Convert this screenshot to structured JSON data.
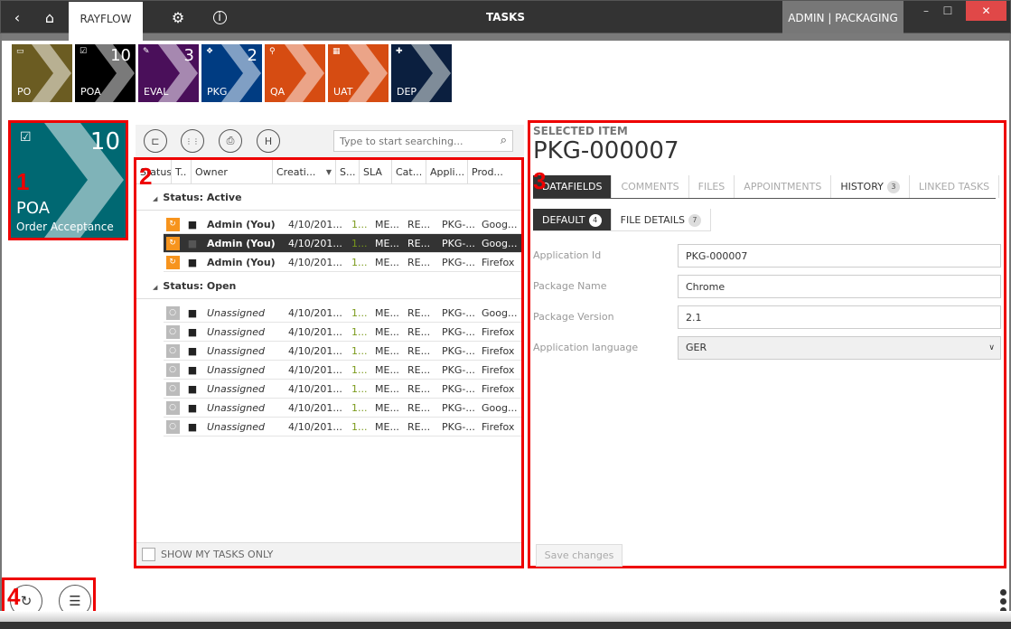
{
  "titlebar": {
    "back_icon": "chevron-left-icon",
    "home_icon": "home-icon",
    "app_tab": "RAYFLOW",
    "settings_icon": "gear-icon",
    "info_icon": "info-icon",
    "title": "TASKS",
    "user": "ADMIN | PACKAGING",
    "minimize": "–",
    "maximize": "☐",
    "close": "✕"
  },
  "tiles": [
    {
      "label": "PO",
      "count": "",
      "color": "#6b5c22",
      "chev": "#b8b092",
      "icon": "▭"
    },
    {
      "label": "POA",
      "count": "10",
      "color": "#000000",
      "chev": "#7a7a7a",
      "icon": "☑"
    },
    {
      "label": "EVAL",
      "count": "3",
      "color": "#4a0f5a",
      "chev": "#a688b0",
      "icon": "✎"
    },
    {
      "label": "PKG",
      "count": "2",
      "color": "#003c82",
      "chev": "#809fc4",
      "icon": "❖"
    },
    {
      "label": "QA",
      "count": "",
      "color": "#d64c12",
      "chev": "#eba488",
      "icon": "⚲"
    },
    {
      "label": "UAT",
      "count": "",
      "color": "#d64c12",
      "chev": "#eba488",
      "icon": "▦"
    },
    {
      "label": "DEP",
      "count": "",
      "color": "#0b1f3f",
      "chev": "#7f8c99",
      "icon": "✚"
    }
  ],
  "selected_stage": {
    "name": "POA",
    "description": "Order Acceptance",
    "count": "10",
    "color": "#006872",
    "chev": "#7fb3b8",
    "icon": "☑"
  },
  "annotations": {
    "a1": "1",
    "a2": "2",
    "a3": "3",
    "a4": "4"
  },
  "toolbar": {
    "btn1_icon": "⊏",
    "btn2_icon": "⋮⋮",
    "btn3_icon": "⎙",
    "btn4_icon": "H",
    "search_placeholder": "Type to start searching...",
    "search_icon": "⌕"
  },
  "grid": {
    "columns": [
      "Status",
      "T..",
      "Owner",
      "Creati...",
      "S...",
      "SLA",
      "Cat...",
      "Appli...",
      "Prod..."
    ],
    "sort_indicator": "▼",
    "groups": [
      {
        "label": "Status: Active",
        "rows": [
          {
            "owner": "Admin (You)",
            "date": "4/10/201...",
            "s": "1...",
            "sla": "ME...",
            "cat": "RE...",
            "app": "PKG-...",
            "prod": "Goog...",
            "selected": false
          },
          {
            "owner": "Admin (You)",
            "date": "4/10/201...",
            "s": "1...",
            "sla": "ME...",
            "cat": "RE...",
            "app": "PKG-...",
            "prod": "Goog...",
            "selected": true
          },
          {
            "owner": "Admin (You)",
            "date": "4/10/201...",
            "s": "1...",
            "sla": "ME...",
            "cat": "RE...",
            "app": "PKG-...",
            "prod": "Firefox",
            "selected": false
          }
        ]
      },
      {
        "label": "Status: Open",
        "rows": [
          {
            "owner": "Unassigned",
            "date": "4/10/201...",
            "s": "1...",
            "sla": "ME...",
            "cat": "RE...",
            "app": "PKG-...",
            "prod": "Goog..."
          },
          {
            "owner": "Unassigned",
            "date": "4/10/201...",
            "s": "1...",
            "sla": "ME...",
            "cat": "RE...",
            "app": "PKG-...",
            "prod": "Firefox"
          },
          {
            "owner": "Unassigned",
            "date": "4/10/201...",
            "s": "1...",
            "sla": "ME...",
            "cat": "RE...",
            "app": "PKG-...",
            "prod": "Firefox"
          },
          {
            "owner": "Unassigned",
            "date": "4/10/201...",
            "s": "1...",
            "sla": "ME...",
            "cat": "RE...",
            "app": "PKG-...",
            "prod": "Firefox"
          },
          {
            "owner": "Unassigned",
            "date": "4/10/201...",
            "s": "1...",
            "sla": "ME...",
            "cat": "RE...",
            "app": "PKG-...",
            "prod": "Firefox"
          },
          {
            "owner": "Unassigned",
            "date": "4/10/201...",
            "s": "1...",
            "sla": "ME...",
            "cat": "RE...",
            "app": "PKG-...",
            "prod": "Goog..."
          },
          {
            "owner": "Unassigned",
            "date": "4/10/201...",
            "s": "1...",
            "sla": "ME...",
            "cat": "RE...",
            "app": "PKG-...",
            "prod": "Firefox"
          }
        ]
      }
    ],
    "footer_checkbox": "SHOW MY TASKS ONLY"
  },
  "detail": {
    "label": "SELECTED ITEM",
    "id": "PKG-000007",
    "tabs": [
      {
        "label": "DATAFIELDS",
        "badge": "",
        "active": true
      },
      {
        "label": "COMMENTS",
        "badge": ""
      },
      {
        "label": "FILES",
        "badge": ""
      },
      {
        "label": "APPOINTMENTS",
        "badge": ""
      },
      {
        "label": "HISTORY",
        "badge": "3"
      },
      {
        "label": "LINKED TASKS",
        "badge": ""
      }
    ],
    "subtabs": [
      {
        "label": "DEFAULT",
        "badge": "4",
        "active": true
      },
      {
        "label": "FILE DETAILS",
        "badge": "7"
      }
    ],
    "fields": [
      {
        "label": "Application Id",
        "value": "PKG-000007",
        "type": "text"
      },
      {
        "label": "Package Name",
        "value": "Chrome",
        "type": "text"
      },
      {
        "label": "Package Version",
        "value": "2.1",
        "type": "text"
      },
      {
        "label": "Application language",
        "value": "GER",
        "type": "select"
      }
    ],
    "save_label": "Save changes"
  },
  "bottom": {
    "refresh_icon": "↻",
    "list_icon": "☰"
  }
}
